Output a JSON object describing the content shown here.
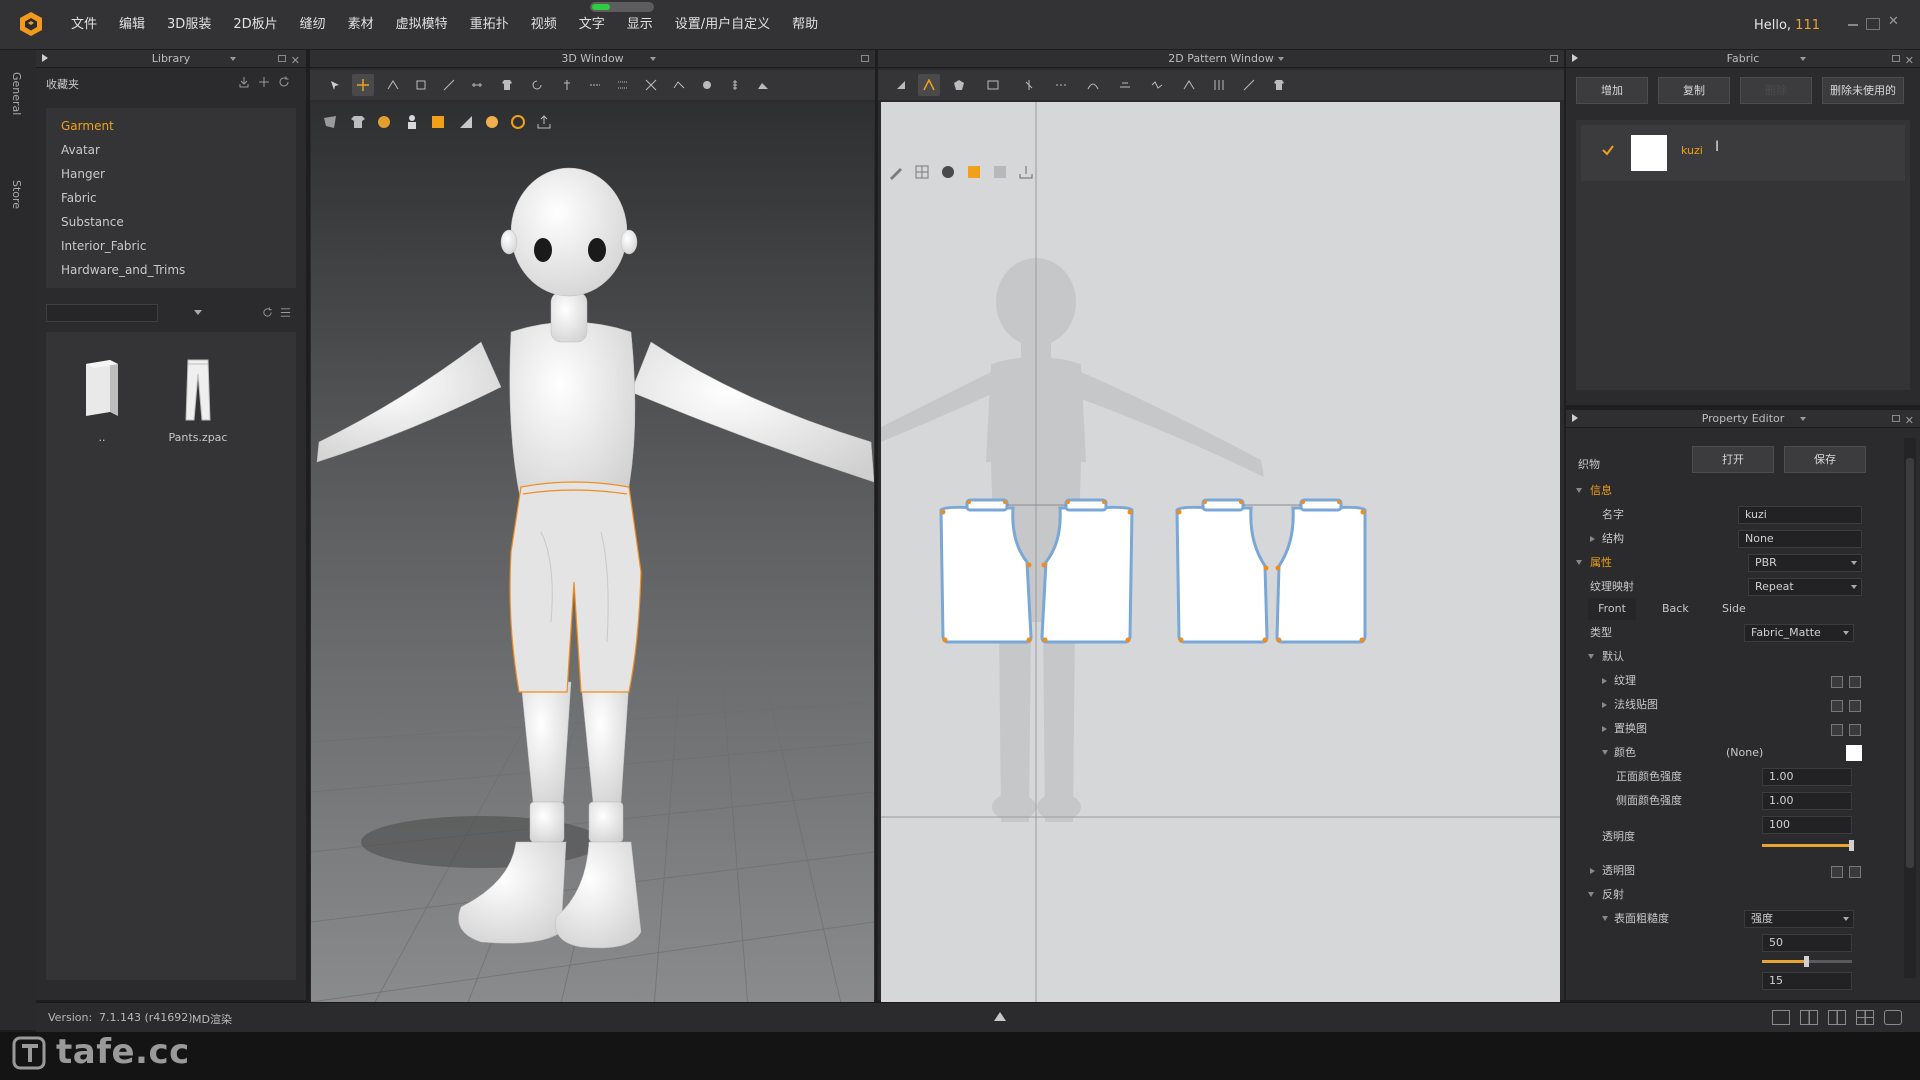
{
  "app": {
    "menus": [
      "文件",
      "编辑",
      "3D服装",
      "2D板片",
      "缝纫",
      "素材",
      "虚拟模特",
      "重拓扑",
      "视频",
      "文字",
      "显示",
      "设置/用户自定义",
      "帮助"
    ],
    "greeting_prefix": "Hello, ",
    "username": "111",
    "progress": 0.3
  },
  "left_strip": {
    "tabs": [
      "General",
      "Store"
    ]
  },
  "library": {
    "title": "Library",
    "favorites_label": "收藏夹",
    "tree": [
      "Garment",
      "Avatar",
      "Hanger",
      "Fabric",
      "Substance",
      "Interior_Fabric",
      "Hardware_and_Trims"
    ],
    "selected": "Garment",
    "search_value": "",
    "files": [
      {
        "name": "..",
        "icon": "folder-up-icon"
      },
      {
        "name": "Pants.zpac",
        "icon": "pants-file-icon"
      }
    ]
  },
  "window3d": {
    "title": "3D Window",
    "toolbar_icons": [
      "select-mesh-icon",
      "move-icon",
      "select-point-icon",
      "tack-icon",
      "fold-icon",
      "measure-icon",
      "garment-icon",
      "rotate-icon",
      "pin-icon",
      "strap-icon",
      "tape-icon",
      "cut-icon",
      "bond-icon",
      "button-icon",
      "zipper-icon",
      "trim-icon"
    ],
    "toolbar2_icons": [
      "cloth-icon",
      "shirt-icon",
      "avatar-icon",
      "body-icon",
      "fabric-icon",
      "texture-icon",
      "skin-icon",
      "globe-icon",
      "export-icon"
    ]
  },
  "window2d": {
    "title": "2D Pattern Window",
    "toolbar_icons": [
      "transform-icon",
      "edit-pattern-icon",
      "polygon-icon",
      "rectangle-icon",
      "internal-line-icon",
      "segment-sewing-icon",
      "free-sewing-icon",
      "fold-arrange-icon",
      "trace-icon",
      "notch-icon",
      "pleat-icon",
      "measure-2d-icon",
      "tshirt-icon"
    ],
    "toolbar2_icons": [
      "brush-icon",
      "grid-icon",
      "symmetry-icon",
      "fabric-2d-icon",
      "texture-2d-icon",
      "bake-icon"
    ]
  },
  "fabric": {
    "title": "Fabric",
    "buttons": [
      "增加",
      "复制",
      "删除",
      "删除未使用的"
    ],
    "items": [
      {
        "name": "kuzi",
        "color": "#ffffff",
        "checked": true
      }
    ]
  },
  "property_editor": {
    "title": "Property Editor",
    "section_label": "织物",
    "open_button": "打开",
    "save_button": "保存",
    "info_label": "信息",
    "name_label": "名字",
    "name_value": "kuzi",
    "structure_label": "结构",
    "structure_value": "None",
    "attributes_label": "属性",
    "attributes_value": "PBR",
    "texture_mapping_label": "纹理映射",
    "texture_mapping_value": "Repeat",
    "tabs": [
      "Front",
      "Back",
      "Side"
    ],
    "type_label": "类型",
    "type_value": "Fabric_Matte",
    "default_label": "默认",
    "texture_label": "纹理",
    "normal_map_label": "法线贴图",
    "displacement_label": "置换图",
    "color_label": "颜色",
    "color_value": "(None)",
    "color_swatch": "#ffffff",
    "front_color_strength_label": "正面颜色强度",
    "front_color_strength": "1.00",
    "side_color_strength_label": "侧面颜色强度",
    "side_color_strength": "1.00",
    "opacity_label": "透明度",
    "opacity_value": "100",
    "opacity_fraction": 1.0,
    "opacity_map_label": "透明图",
    "reflection_label": "反射",
    "roughness_label": "表面粗糙度",
    "roughness_mode": "强度",
    "roughness_value": "50",
    "roughness_fraction": 0.5,
    "next_value": "15"
  },
  "statusbar": {
    "version_label": "Version:",
    "version_value": "7.1.143 (r41692)",
    "mode_label": "MD渲染"
  },
  "watermark": {
    "text": "tafe.cc"
  },
  "colors": {
    "accent_orange": "#f0a01a",
    "pattern_outline": "#7aa7d6",
    "pattern_notch": "#f08c1c",
    "canvas2d": "#d6d7d9"
  }
}
